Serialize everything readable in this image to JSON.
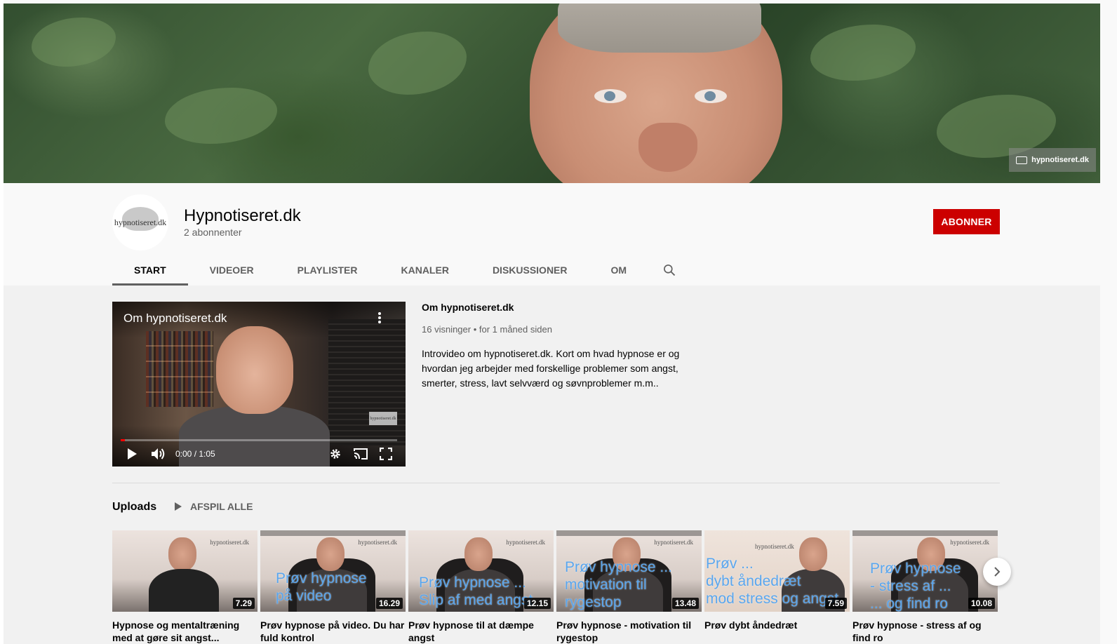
{
  "banner": {
    "watermark": "hypnotiseret.dk"
  },
  "channel": {
    "avatar_text": "hypnotiseret.dk",
    "title": "Hypnotiseret.dk",
    "subscribers": "2 abonnenter",
    "subscribe_label": "ABONNER"
  },
  "tabs": [
    {
      "label": "START",
      "active": true
    },
    {
      "label": "VIDEOER"
    },
    {
      "label": "PLAYLISTER"
    },
    {
      "label": "KANALER"
    },
    {
      "label": "DISKUSSIONER"
    },
    {
      "label": "OM"
    }
  ],
  "featured": {
    "player_title": "Om hypnotiseret.dk",
    "player_watermark": "hypnotiseret.dk",
    "time": "0:00 / 1:05",
    "progress": 0.0,
    "title": "Om hypnotiseret.dk",
    "meta": "16 visninger • for 1 måned siden",
    "description": "Introvideo om hypnotiseret.dk. Kort om hvad hypnose er og hvordan jeg arbejder med forskellige problemer som angst, smerter, stress, lavt selvværd og søvnproblemer m.m.."
  },
  "uploads": {
    "title": "Uploads",
    "play_all": "AFSPIL ALLE",
    "videos": [
      {
        "title": "Hypnose og mentaltræning med at gøre sit angst...",
        "duration": "7.29",
        "overlay": "",
        "logo": "hypnotiseret.dk"
      },
      {
        "title": "Prøv hypnose på video. Du har fuld kontrol",
        "duration": "16.29",
        "overlay": "Prøv hypnose\npå video",
        "logo": "hypnotiseret.dk"
      },
      {
        "title": "Prøv hypnose til at dæmpe angst",
        "duration": "12.15",
        "overlay": "Prøv hypnose ...\nSlip af med angst",
        "logo": "hypnotiseret.dk"
      },
      {
        "title": "Prøv hypnose - motivation til rygestop",
        "duration": "13.48",
        "overlay": "Prøv hypnose ...\nmotivation til\nrygestop",
        "logo": "hypnotiseret.dk"
      },
      {
        "title": "Prøv dybt åndedræt",
        "duration": "7.59",
        "overlay": "Prøv ...\ndybt åndedræt\nmod stress og angst",
        "logo": "hypnotiseret.dk"
      },
      {
        "title": "Prøv hypnose - stress af og find ro",
        "duration": "10.08",
        "overlay": "Prøv hypnose\n- stress af ...\n... og find ro",
        "logo": "hypnotiseret.dk"
      }
    ]
  },
  "icons": {
    "search": "search-icon",
    "play": "play-icon",
    "volume": "volume-icon",
    "settings": "gear-icon",
    "cast": "cast-icon",
    "fullscreen": "fullscreen-icon",
    "more": "more-vert-icon",
    "next": "chevron-right-icon"
  },
  "colors": {
    "subscribe": "#cc0000",
    "progress": "#ff0000",
    "overlay_text": "#5aa6ee"
  }
}
